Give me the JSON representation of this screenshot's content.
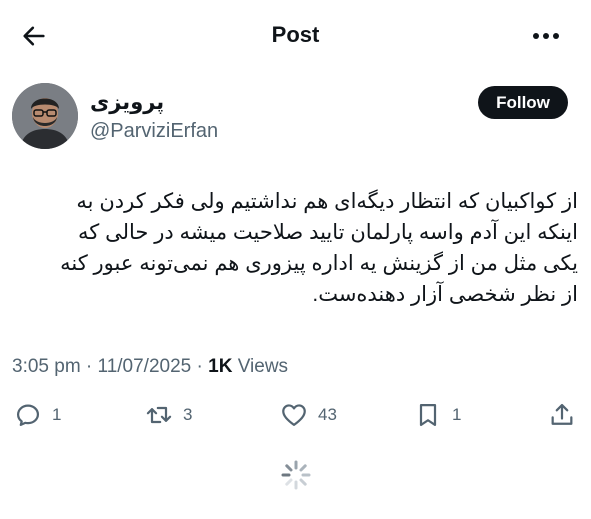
{
  "header": {
    "title": "Post",
    "back_icon": "arrow-left-icon",
    "more_icon": "more-horizontal-icon"
  },
  "author": {
    "display_name": "پرویزی",
    "handle": "@ParviziErfan",
    "follow_label": "Follow"
  },
  "tweet": {
    "lines": [
      "از کواکبیان که انتظار دیگه‌ای هم نداشتیم ولی فکر کردن به",
      "اینکه این آدم واسه پارلمان تایید صلاحیت میشه در حالی که",
      "یکی مثل من از گزینش یه اداره پیزوری هم نمی‌تونه عبور کنه",
      "از نظر شخصی آزار دهنده‌ست."
    ]
  },
  "meta": {
    "time": "3:05 pm",
    "separator": " · ",
    "date": "11/07/2025",
    "views_count": "1K",
    "views_label": " Views"
  },
  "actions": {
    "reply": {
      "icon": "reply-icon",
      "count": "1"
    },
    "repost": {
      "icon": "repost-icon",
      "count": "3"
    },
    "like": {
      "icon": "heart-icon",
      "count": "43"
    },
    "bookmark": {
      "icon": "bookmark-icon",
      "count": "1"
    },
    "share": {
      "icon": "share-icon"
    }
  },
  "colors": {
    "text": "#0f1419",
    "secondary": "#536471",
    "button": "#0f1419"
  }
}
